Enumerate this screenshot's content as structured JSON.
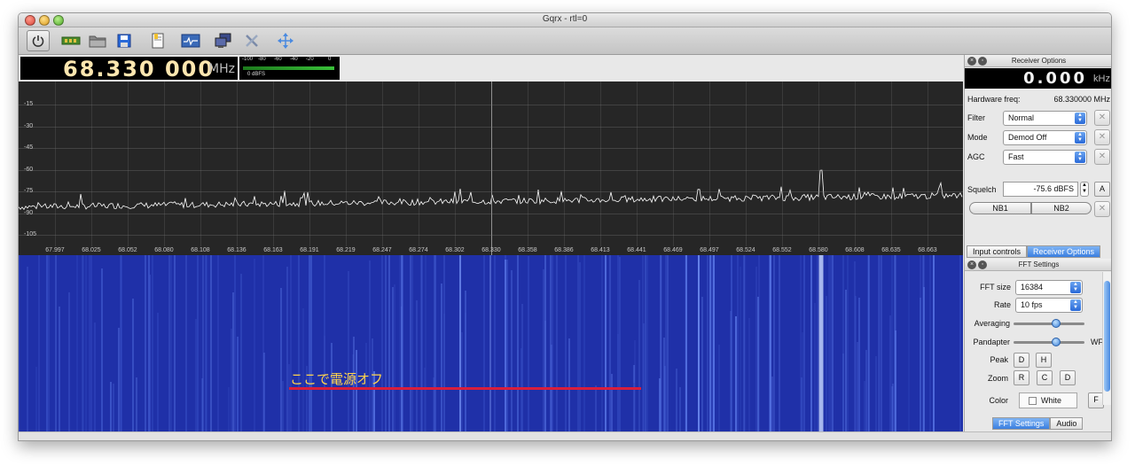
{
  "window": {
    "title": "Gqrx  -  rtl=0"
  },
  "toolbar": {
    "icons": [
      "power-icon",
      "device-icon",
      "open-folder-icon",
      "save-icon",
      "edit-icon",
      "display-icon",
      "network-icon",
      "tools-icon",
      "fullscreen-icon"
    ]
  },
  "frequency": {
    "digits": "68.330 000",
    "unit": "MHz"
  },
  "meter": {
    "ticks": [
      "-100",
      "-80",
      "-60",
      "-40",
      "-20",
      "0"
    ],
    "label": "0 dBFS"
  },
  "spectrum": {
    "y_labels": [
      "-15",
      "-30",
      "-45",
      "-60",
      "-75",
      "-90",
      "-105"
    ],
    "x_labels": [
      "67.997",
      "68.025",
      "68.052",
      "68.080",
      "68.108",
      "68.136",
      "68.163",
      "68.191",
      "68.219",
      "68.247",
      "68.274",
      "68.302",
      "68.330",
      "68.358",
      "68.386",
      "68.413",
      "68.441",
      "68.469",
      "68.497",
      "68.524",
      "68.552",
      "68.580",
      "68.608",
      "68.635",
      "68.663"
    ],
    "colors": {
      "trace": "#ffffff",
      "background": "#262626"
    }
  },
  "waterfall": {
    "annotation": "ここで電源オフ",
    "colors": {
      "background": "#1f30a8",
      "annotation_text": "#ffd44d",
      "annotation_line": "#d81e3c"
    }
  },
  "receiver_options": {
    "title": "Receiver Options",
    "offset": {
      "digits": "0.000",
      "unit": "kHz"
    },
    "hardware_freq": {
      "label": "Hardware freq:",
      "value": "68.330000 MHz"
    },
    "filter": {
      "label": "Filter",
      "value": "Normal"
    },
    "mode": {
      "label": "Mode",
      "value": "Demod Off"
    },
    "agc": {
      "label": "AGC",
      "value": "Fast"
    },
    "squelch": {
      "label": "Squelch",
      "value": "-75.6 dBFS",
      "auto_label": "A"
    },
    "nb1": "NB1",
    "nb2": "NB2",
    "tabs": [
      "Input controls",
      "Receiver Options"
    ],
    "active_tab": "Receiver Options"
  },
  "fft_settings": {
    "title": "FFT Settings",
    "fft_size": {
      "label": "FFT size",
      "value": "16384"
    },
    "rate": {
      "label": "Rate",
      "value": "10 fps"
    },
    "averaging": {
      "label": "Averaging",
      "level": 0.6
    },
    "pandapter": {
      "label": "Pandapter",
      "level": 0.6,
      "end_label": "WF"
    },
    "peak": {
      "label": "Peak",
      "buttons": [
        "D",
        "H"
      ]
    },
    "zoom": {
      "label": "Zoom",
      "buttons": [
        "R",
        "C",
        "D"
      ]
    },
    "color": {
      "label": "Color",
      "checkbox_label": "White",
      "checked": false,
      "fill_label": "F"
    },
    "tabs": [
      "FFT Settings",
      "Audio"
    ],
    "active_tab": "FFT Settings"
  }
}
